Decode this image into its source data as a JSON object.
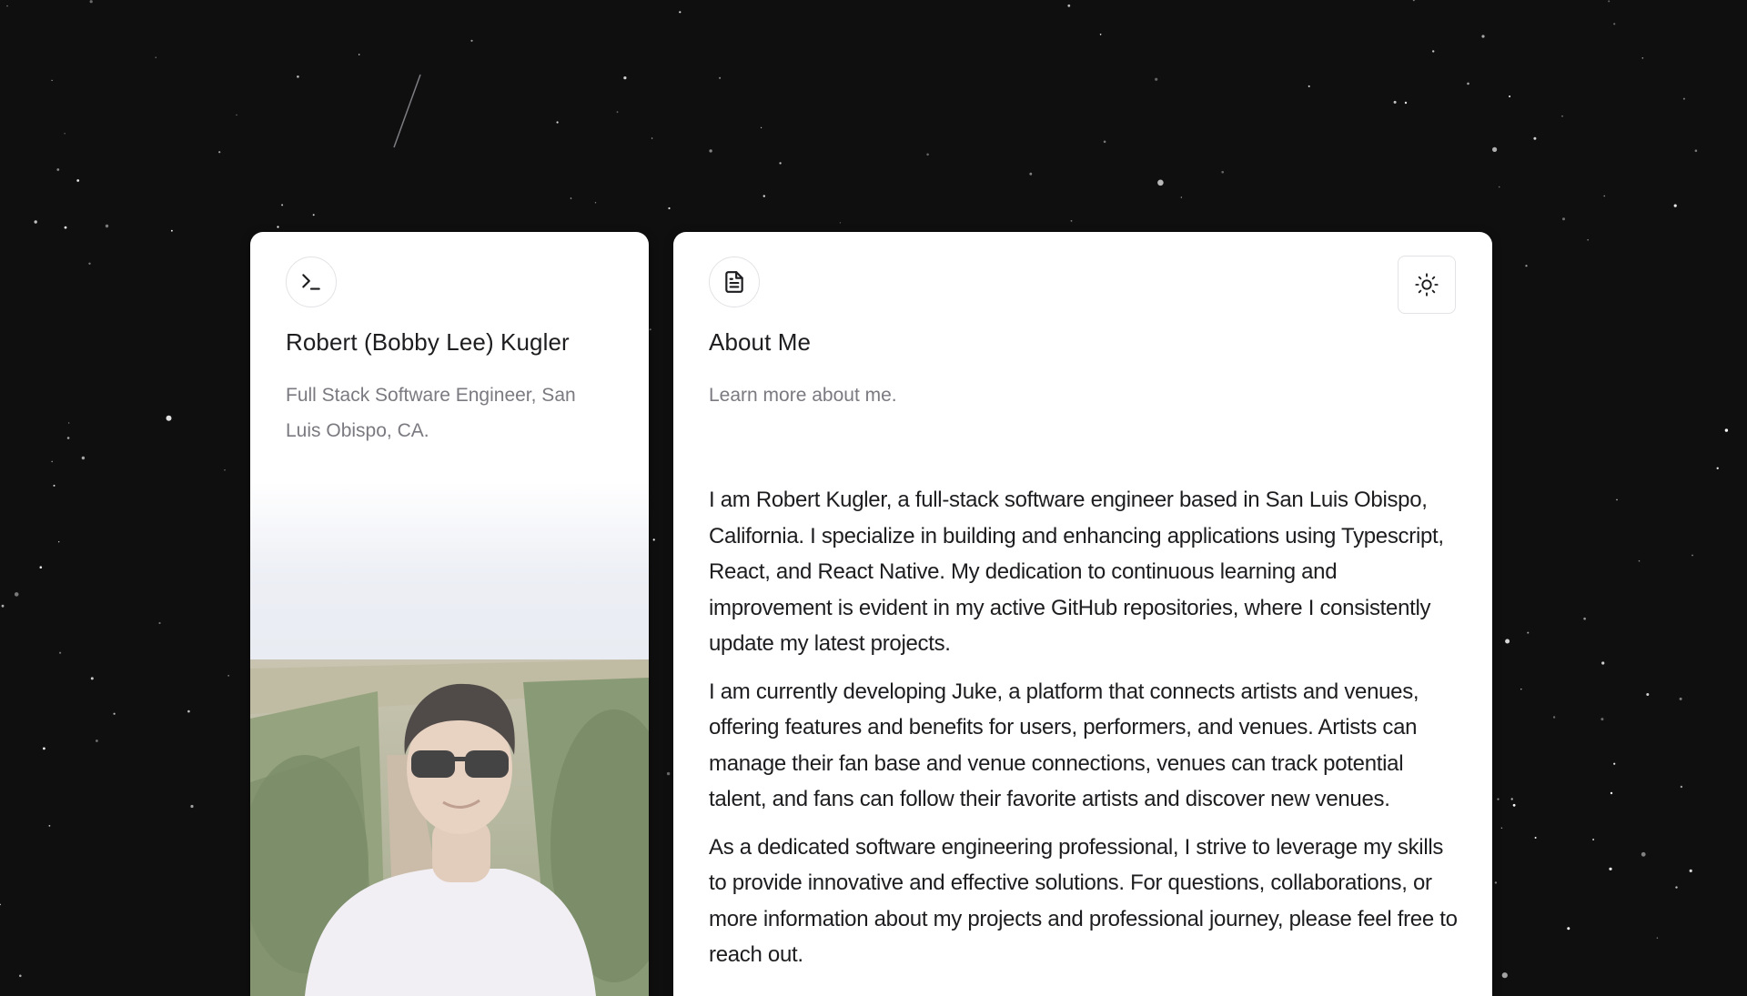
{
  "profile": {
    "icon": "terminal-icon",
    "name": "Robert (Bobby Lee) Kugler",
    "subtitle": "Full Stack Software Engineer, San Luis Obispo, CA."
  },
  "about": {
    "icon": "document-icon",
    "title": "About Me",
    "subtitle": "Learn more about me.",
    "theme_toggle_icon": "sun-icon",
    "paragraphs": [
      "I am Robert Kugler, a full-stack software engineer based in San Luis Obispo, California. I specialize in building and enhancing applications using Typescript, React, and React Native. My dedication to continuous learning and improvement is evident in my active GitHub repositories, where I consistently update my latest projects.",
      "I am currently developing Juke, a platform that connects artists and venues, offering features and benefits for users, performers, and venues. Artists can manage their fan base and venue connections, venues can track potential talent, and fans can follow their favorite artists and discover new venues.",
      "As a dedicated software engineering professional, I strive to leverage my skills to provide innovative and effective solutions. For questions, collaborations, or more information about my projects and professional journey, please feel free to reach out."
    ]
  },
  "colors": {
    "background": "#0f0f10",
    "card": "#ffffff",
    "text": "#1d1d20",
    "muted": "#7a7a80"
  }
}
